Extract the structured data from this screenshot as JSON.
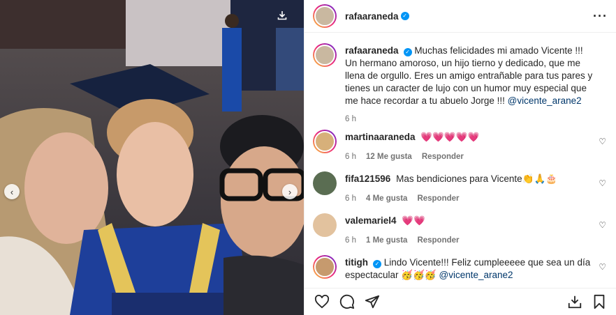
{
  "post": {
    "author": "rafaaraneda",
    "caption_user": "rafaaraneda",
    "caption_text": "Muchas felicidades mi amado Vicente !!! Un hermano amoroso, un hijo tierno y dedicado, que me llena de orgullo. Eres un amigo entrañable para tus pares y tienes un caracter de lujo con un humor muy especial que me hace recordar a tu abuelo Jorge !!!",
    "caption_mention": "@vicente_arane2",
    "caption_time": "6 h"
  },
  "comments": [
    {
      "user": "martinaaraneda",
      "text": "💗💗💗💗💗",
      "time": "6 h",
      "likes": "12 Me gusta",
      "reply": "Responder"
    },
    {
      "user": "fifa121596",
      "text": "Mas bendiciones para Vicente👏🙏🎂",
      "time": "6 h",
      "likes": "4 Me gusta",
      "reply": "Responder"
    },
    {
      "user": "valemariel4",
      "text": "💗💗",
      "time": "6 h",
      "likes": "1 Me gusta",
      "reply": "Responder"
    },
    {
      "user": "titigh",
      "text": "Lindo Vicente!!! Feliz cumpleeeee que sea un día espectacular 🥳🥳🥳",
      "mention": "@vicente_arane2"
    }
  ],
  "icons": {
    "like": "heart-icon",
    "comment": "comment-icon",
    "share": "share-icon",
    "save": "bookmark-icon",
    "download": "download-icon"
  },
  "colors": {
    "accent": "#0095f6",
    "mention": "#00376b",
    "muted": "#737373"
  }
}
